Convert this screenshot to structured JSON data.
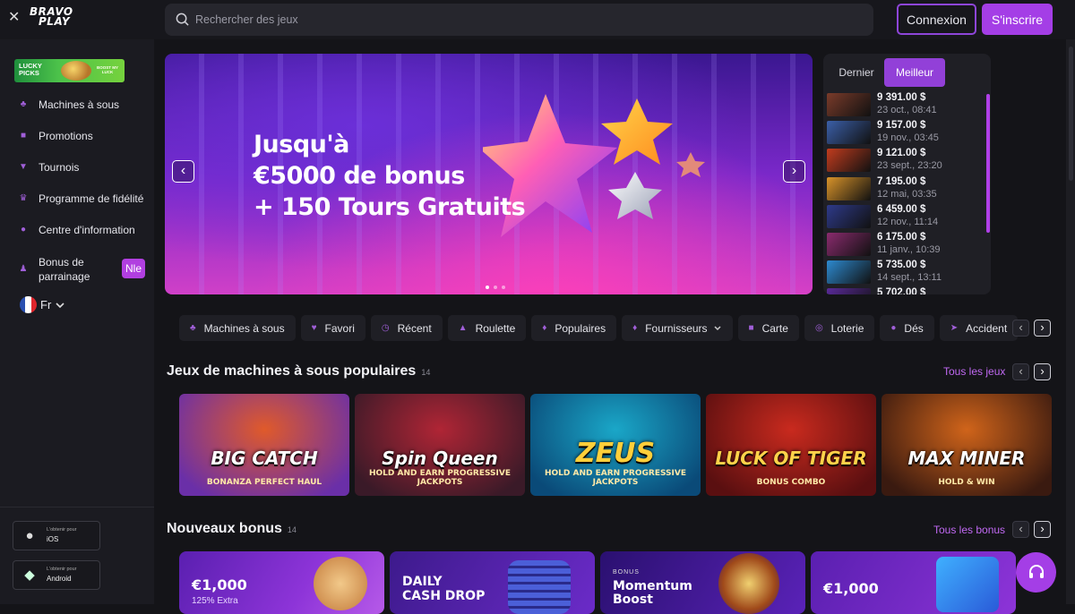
{
  "header": {
    "logo_line1": "BRAVO",
    "logo_line2": "PLAY",
    "search_placeholder": "Rechercher des jeux",
    "login_label": "Connexion",
    "signup_label": "S'inscrire"
  },
  "sidebar": {
    "promo_banner_left": "LUCKY PICKS",
    "promo_banner_right": "BOOST MY LUCK",
    "items": [
      {
        "label": "Machines à sous",
        "icon": "slots-icon"
      },
      {
        "label": "Promotions",
        "icon": "gift-icon"
      },
      {
        "label": "Tournois",
        "icon": "trophy-icon"
      },
      {
        "label": "Programme de fidélité",
        "icon": "crown-icon"
      },
      {
        "label": "Centre d'information",
        "icon": "info-icon"
      },
      {
        "label": "Bonus de parrainage",
        "icon": "referral-icon"
      }
    ],
    "new_badge": "Nle",
    "language": "Fr",
    "apps": [
      {
        "small": "L'obtenir pour",
        "name": "iOS",
        "icon": "apple-icon"
      },
      {
        "small": "L'obtenir pour",
        "name": "Android",
        "icon": "android-icon"
      }
    ]
  },
  "hero": {
    "title_line1": "Jusqu'à",
    "title_line2": "€5000 de bonus",
    "title_line3": "+ 150 Tours Gratuits",
    "slide_index": 1,
    "slide_count": 3
  },
  "winners": {
    "tabs": [
      "Dernier",
      "Meilleur"
    ],
    "active_tab": "Meilleur",
    "rows": [
      {
        "amount": "9 391.00 $",
        "date": "23 oct., 08:41",
        "thumb": "#7a3b2a"
      },
      {
        "amount": "9 157.00 $",
        "date": "19 nov., 03:45",
        "thumb": "#3b5fa8"
      },
      {
        "amount": "9 121.00 $",
        "date": "23 sept., 23:20",
        "thumb": "#c23c1e"
      },
      {
        "amount": "7 195.00 $",
        "date": "12 mai, 03:35",
        "thumb": "#d8932a"
      },
      {
        "amount": "6 459.00 $",
        "date": "12 nov., 11:14",
        "thumb": "#2e3a8a"
      },
      {
        "amount": "6 175.00 $",
        "date": "11 janv., 10:39",
        "thumb": "#8a2b6e"
      },
      {
        "amount": "5 735.00 $",
        "date": "14 sept., 13:11",
        "thumb": "#2d8ad0"
      },
      {
        "amount": "5 702.00 $",
        "date": "",
        "thumb": "#5a2a9a"
      }
    ]
  },
  "categories": [
    {
      "label": "Machines à sous",
      "icon": "slots-icon"
    },
    {
      "label": "Favori",
      "icon": "heart-icon"
    },
    {
      "label": "Récent",
      "icon": "clock-icon"
    },
    {
      "label": "Roulette",
      "icon": "roulette-icon"
    },
    {
      "label": "Populaires",
      "icon": "flame-icon"
    },
    {
      "label": "Fournisseurs",
      "icon": "diamond-icon"
    },
    {
      "label": "Carte",
      "icon": "cards-icon"
    },
    {
      "label": "Loterie",
      "icon": "lottery-icon"
    },
    {
      "label": "Dés",
      "icon": "dice-icon"
    },
    {
      "label": "Accident",
      "icon": "rocket-icon"
    }
  ],
  "popular_slots": {
    "title": "Jeux de machines à sous populaires",
    "count": "14",
    "see_all": "Tous les jeux",
    "games": [
      {
        "title": "BIG CATCH",
        "subtitle": "BONANZA PERFECT HAUL",
        "c1": "#e05a2a",
        "c2": "#6a2fa8"
      },
      {
        "title": "Spin Queen",
        "subtitle": "HOLD AND EARN PROGRESSIVE JACKPOTS",
        "c1": "#b02535",
        "c2": "#3a1a28"
      },
      {
        "title": "ZEUS",
        "subtitle": "HOLD AND EARN PROGRESSIVE JACKPOTS",
        "c1": "#1aa7c8",
        "c2": "#0a4a78"
      },
      {
        "title": "LUCK OF TIGER",
        "subtitle": "BONUS COMBO",
        "c1": "#c92a1e",
        "c2": "#5a0f10"
      },
      {
        "title": "MAX MINER",
        "subtitle": "HOLD & WIN",
        "c1": "#d0641a",
        "c2": "#3a1a10"
      }
    ]
  },
  "new_bonuses": {
    "title": "Nouveaux bonus",
    "count": "14",
    "see_all": "Tous les bonus",
    "cards": [
      {
        "line1": "€1,000",
        "line2": "125% Extra"
      },
      {
        "line1": "DAILY",
        "line2": "CASH DROP"
      },
      {
        "line0": "BONUS",
        "line1": "Momentum",
        "line2": "Boost"
      },
      {
        "line1": "€1,000",
        "line2": ""
      }
    ]
  },
  "colors": {
    "accent": "#a43ee6",
    "link": "#c069f2",
    "background": "#141418",
    "sidebar": "#1b1b21"
  }
}
